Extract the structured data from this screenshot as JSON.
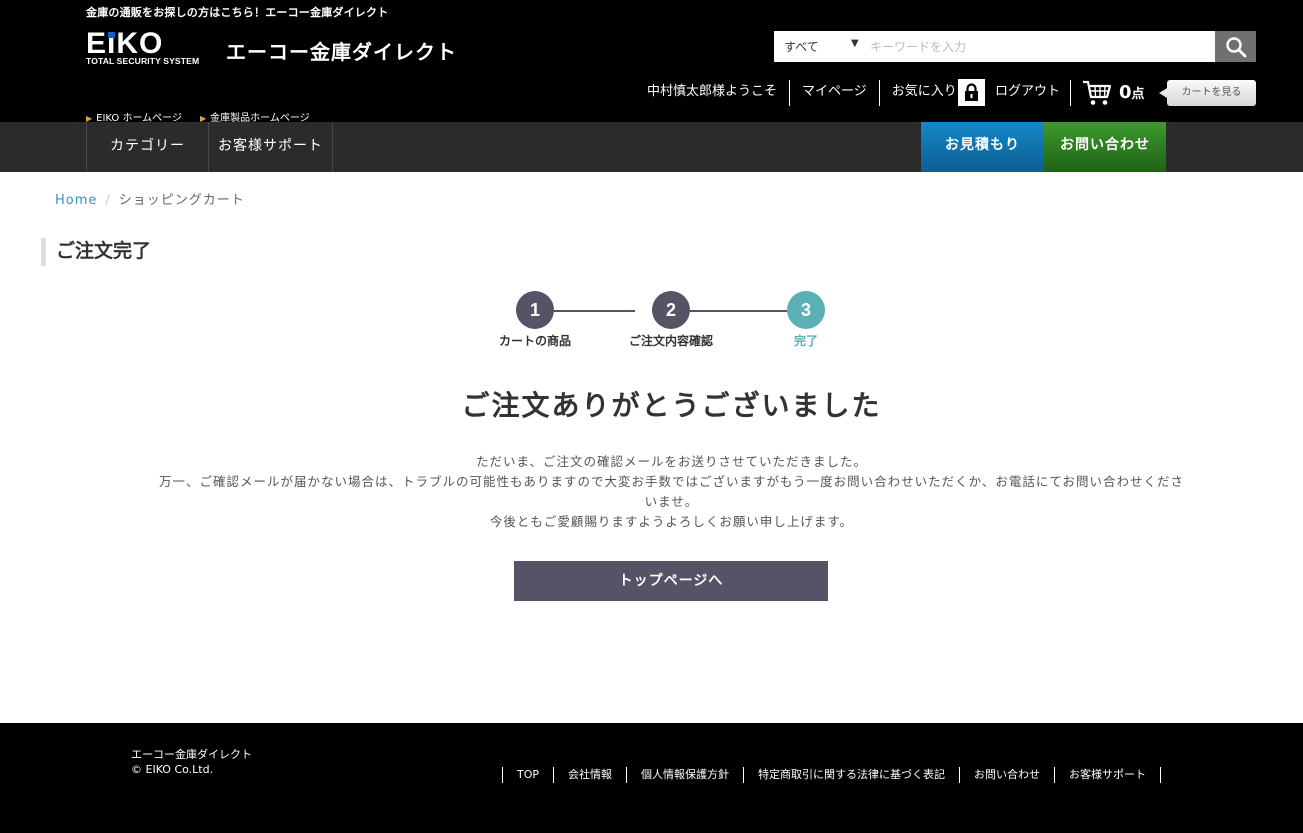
{
  "header": {
    "tagline": "金庫の通販をお探しの方はこちら！エーコー金庫ダイレクト",
    "logo_text": "EIKO",
    "logo_sub": "TOTAL SECURITY SYSTEM",
    "site_title": "エーコー金庫ダイレクト",
    "search": {
      "category": "すべて",
      "placeholder": "キーワードを入力"
    },
    "utility": {
      "welcome": "中村慎太郎様ようこそ",
      "mypage": "マイページ",
      "favorites": "お気に入り",
      "logout": "ログアウト"
    },
    "cart": {
      "count": "0",
      "unit": "点",
      "view_label": "カートを見る"
    },
    "sublinks": [
      "EIKO ホームページ",
      "金庫製品ホームページ"
    ]
  },
  "nav": {
    "category": "カテゴリー",
    "support": "お客様サポート",
    "estimate": "お見積もり",
    "contact": "お問い合わせ"
  },
  "breadcrumb": {
    "home": "Home",
    "separator": "/",
    "current": "ショッピングカート"
  },
  "page_title": "ご注文完了",
  "steps": [
    {
      "number": "1",
      "label": "カートの商品",
      "state": "done"
    },
    {
      "number": "2",
      "label": "ご注文内容確認",
      "state": "done"
    },
    {
      "number": "3",
      "label": "完了",
      "state": "current"
    }
  ],
  "colors": {
    "step_done": "#555366",
    "step_current": "#5bb0b4",
    "estimate": "#1688c8",
    "contact": "#3d9a2e"
  },
  "thanks_heading": "ご注文ありがとうございました",
  "message": {
    "line1": "ただいま、ご注文の確認メールをお送りさせていただきました。",
    "line2": "万一、ご確認メールが届かない場合は、トラブルの可能性もありますので大変お手数ではございますがもう一度お問い合わせいただくか、お電話にてお問い合わせくださいませ。",
    "line3": "今後ともご愛顧賜りますようよろしくお願い申し上げます。"
  },
  "top_button": "トップページへ",
  "footer": {
    "name": "エーコー金庫ダイレクト",
    "copyright": "© EIKO Co.Ltd.",
    "links": [
      "TOP",
      "会社情報",
      "個人情報保護方針",
      "特定商取引に関する法律に基づく表記",
      "お問い合わせ",
      "お客様サポート"
    ]
  }
}
